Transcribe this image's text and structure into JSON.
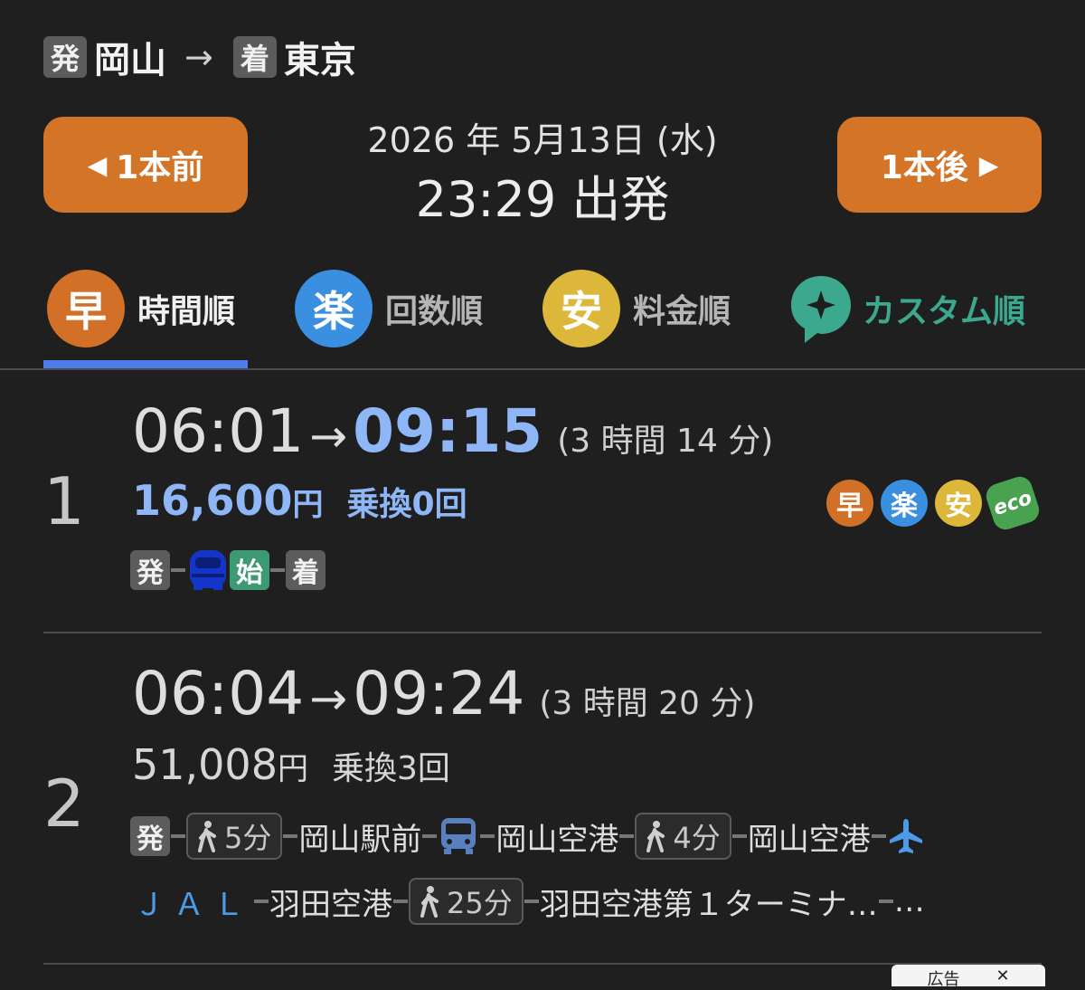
{
  "header": {
    "dep_badge": "発",
    "from": "岡山",
    "arrow": "→",
    "arr_badge": "着",
    "to": "東京",
    "date": "2026 年 5月13日 (水)",
    "time": "23:29 出発",
    "prev_label": "1本前",
    "next_label": "1本後"
  },
  "tabs": [
    {
      "icon": "早",
      "label": "時間順",
      "active": true
    },
    {
      "icon": "楽",
      "label": "回数順",
      "active": false
    },
    {
      "icon": "安",
      "label": "料金順",
      "active": false
    },
    {
      "icon": "sparkle-chat-icon",
      "label": "カスタム順",
      "active": false
    }
  ],
  "results": [
    {
      "num": "1",
      "dep": "06:01",
      "arr": "09:15",
      "duration": "(3 時間 14 分)",
      "fare": "16,600",
      "yen": "円",
      "transfers": "乗換0回",
      "icons": [
        "早",
        "楽",
        "安",
        "eco"
      ],
      "legs": {
        "dep": "発",
        "start": "始",
        "arr": "着"
      }
    },
    {
      "num": "2",
      "dep": "06:04",
      "arr": "09:24",
      "duration": "(3 時間 20 分)",
      "fare": "51,008",
      "yen": "円",
      "transfers": "乗換3回",
      "legs": {
        "dep": "発",
        "walk1": "5分",
        "station1": "岡山駅前",
        "station2": "岡山空港",
        "walk2": "4分",
        "station3": "岡山空港",
        "airline": "ＪＡＬ",
        "station4": "羽田空港",
        "walk3": "25分",
        "station5": "羽田空港第１ターミナ…",
        "more": "…"
      }
    }
  ],
  "ad_label": "広告",
  "colors": {
    "background": "#1f1f1f",
    "accent_orange": "#d47427",
    "accent_blue": "#8fb6f6",
    "tab_underline": "#4d7de8",
    "custom_green": "#3ca88e"
  }
}
